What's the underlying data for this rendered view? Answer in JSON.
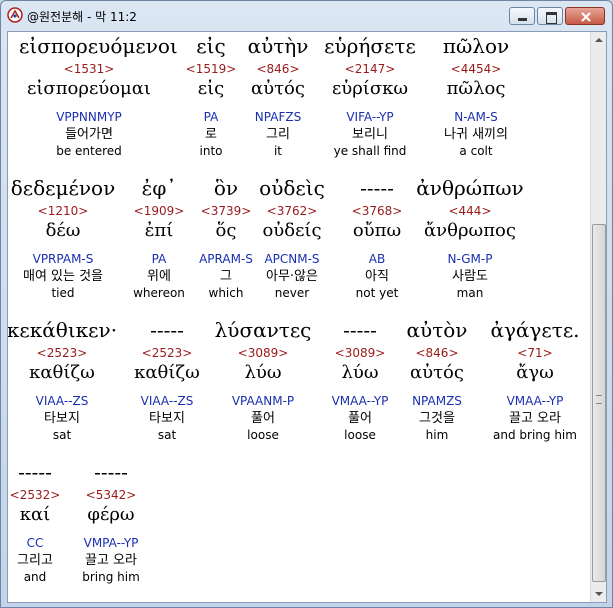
{
  "window": {
    "title": "@원전분해 - 막 11:2"
  },
  "lines": [
    [
      {
        "greek": "εἰσπορευόμενοι",
        "strong": "<1531>",
        "lemma": "εἰσπορεύομαι",
        "morph": "VPPNNMYP",
        "korean": "들어가면",
        "english": "be entered"
      },
      {
        "greek": "εἰς",
        "strong": "<1519>",
        "lemma": "εἰς",
        "morph": "PA",
        "korean": "로",
        "english": "into"
      },
      {
        "greek": "αὐτὴν",
        "strong": "<846>",
        "lemma": "αὐτός",
        "morph": "NPAFZS",
        "korean": "그리",
        "english": "it"
      },
      {
        "greek": "εὑρήσετε",
        "strong": "<2147>",
        "lemma": "εὑρίσκω",
        "morph": "VIFA--YP",
        "korean": "보리니",
        "english": "ye shall find"
      },
      {
        "greek": "πῶλον",
        "strong": "<4454>",
        "lemma": "πῶλος",
        "morph": "N-AM-S",
        "korean": "나귀 새끼의",
        "english": "a colt"
      }
    ],
    [
      {
        "greek": "δεδεμένον",
        "strong": "<1210>",
        "lemma": "δέω",
        "morph": "VPRPAM-S",
        "korean": "매여 있는 것을",
        "english": "tied"
      },
      {
        "greek": "ἐφ᾽",
        "strong": "<1909>",
        "lemma": "ἐπί",
        "morph": "PA",
        "korean": "위에",
        "english": "whereon"
      },
      {
        "greek": "ὃν",
        "strong": "<3739>",
        "lemma": "ὅς",
        "morph": "APRAM-S",
        "korean": "그",
        "english": "which"
      },
      {
        "greek": "οὐδεὶς",
        "strong": "<3762>",
        "lemma": "οὐδείς",
        "morph": "APCNM-S",
        "korean": "아무·않은",
        "english": "never"
      },
      {
        "greek": "-----",
        "strong": "<3768>",
        "lemma": "οὔπω",
        "morph": "AB",
        "korean": "아직",
        "english": "not yet"
      },
      {
        "greek": "ἀνθρώπων",
        "strong": "<444>",
        "lemma": "ἄνθρωπος",
        "morph": "N-GM-P",
        "korean": "사람도",
        "english": "man"
      }
    ],
    [
      {
        "greek": "κεκάθικεν·",
        "strong": "<2523>",
        "lemma": "καθίζω",
        "morph": "VIAA--ZS",
        "korean": "타보지",
        "english": "sat"
      },
      {
        "greek": "-----",
        "strong": "<2523>",
        "lemma": "καθίζω",
        "morph": "VIAA--ZS",
        "korean": "타보지",
        "english": "sat"
      },
      {
        "greek": "λύσαντες",
        "strong": "<3089>",
        "lemma": "λύω",
        "morph": "VPAANM-P",
        "korean": "풀어",
        "english": "loose"
      },
      {
        "greek": "-----",
        "strong": "<3089>",
        "lemma": "λύω",
        "morph": "VMAA--YP",
        "korean": "풀어",
        "english": "loose"
      },
      {
        "greek": "αὐτὸν",
        "strong": "<846>",
        "lemma": "αὐτός",
        "morph": "NPAMZS",
        "korean": "그것을",
        "english": "him"
      },
      {
        "greek": "ἀγάγετε.",
        "strong": "<71>",
        "lemma": "ἄγω",
        "morph": "VMAA--YP",
        "korean": "끌고 오라",
        "english": "and bring him"
      }
    ],
    [
      {
        "greek": "-----",
        "strong": "<2532>",
        "lemma": "καί",
        "morph": "CC",
        "korean": "그리고",
        "english": "and"
      },
      {
        "greek": "-----",
        "strong": "<5342>",
        "lemma": "φέρω",
        "morph": "VMPA--YP",
        "korean": "끌고 오라",
        "english": "bring him"
      }
    ]
  ]
}
